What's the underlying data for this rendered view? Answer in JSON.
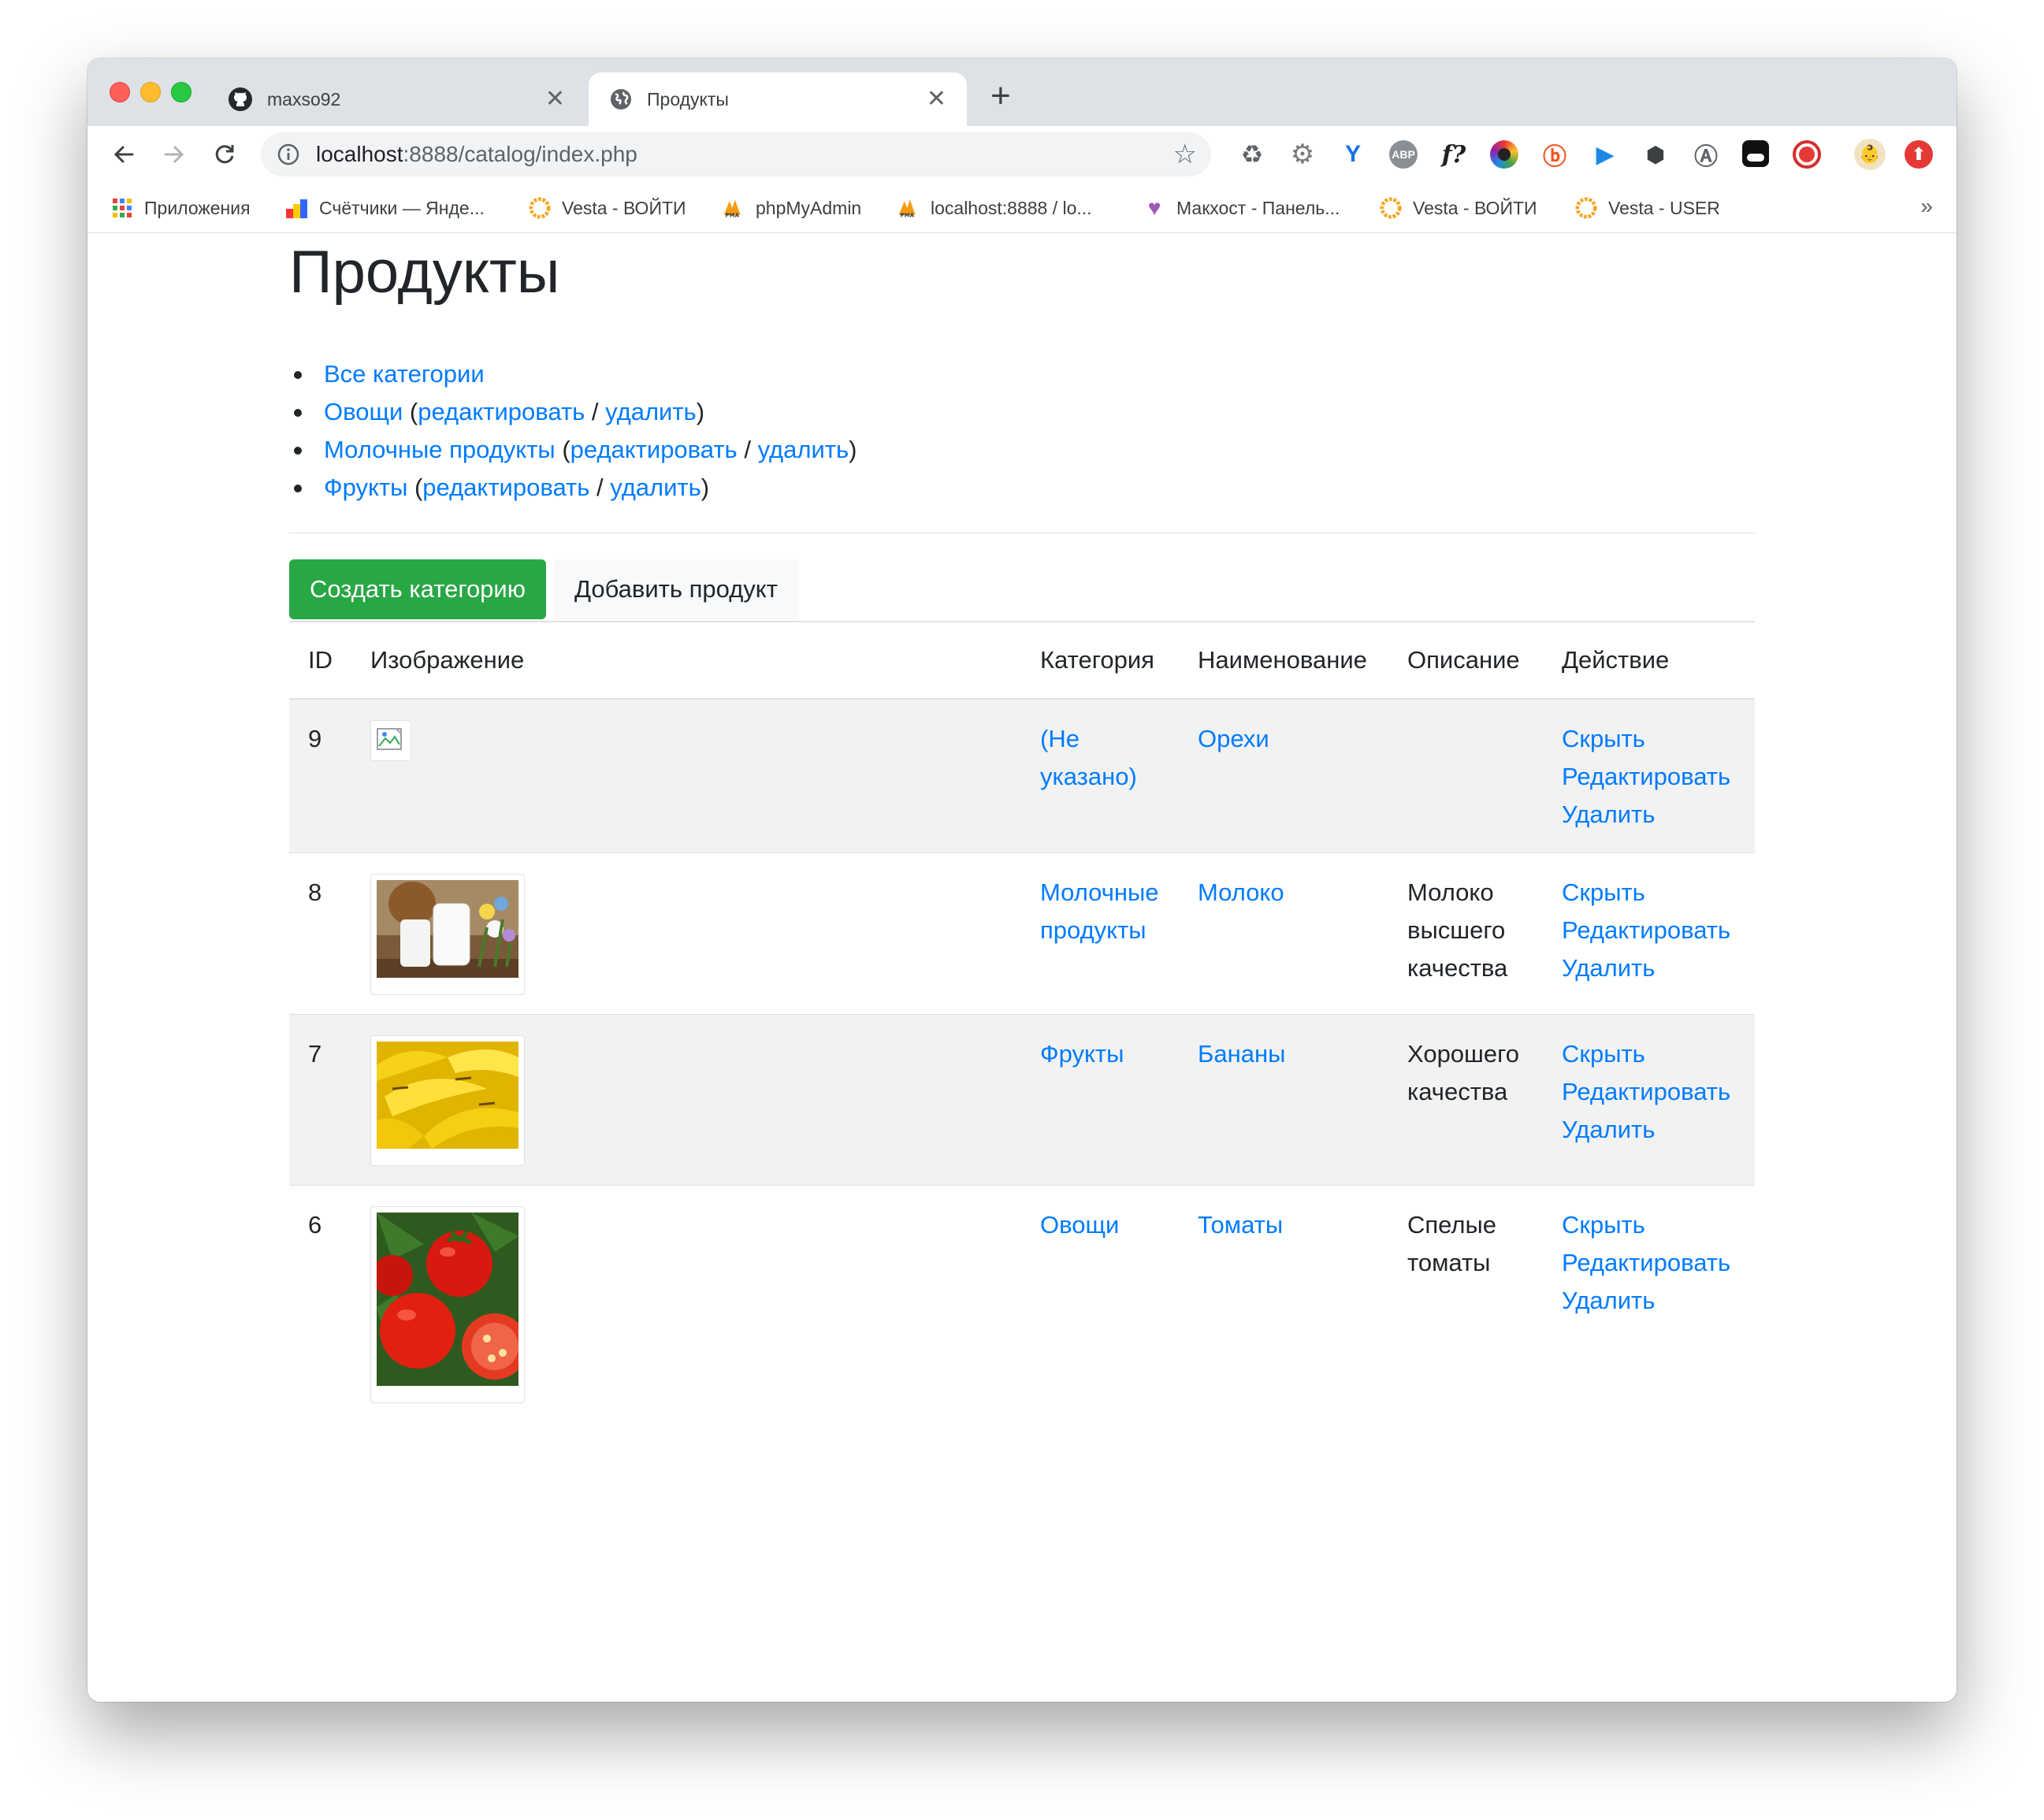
{
  "browser": {
    "tabs": [
      {
        "title": "maxso92",
        "icon": "github-icon",
        "active": false
      },
      {
        "title": "Продукты",
        "icon": "globe-icon",
        "active": true
      }
    ],
    "url_host": "localhost",
    "url_rest": ":8888/catalog/index.php",
    "bookmarks": [
      {
        "label": "Приложения",
        "icon": "apps-grid-icon"
      },
      {
        "label": "Счётчики — Янде...",
        "icon": "metrika-icon"
      },
      {
        "label": "Vesta - ВОЙТИ",
        "icon": "vesta-icon"
      },
      {
        "label": "phpMyAdmin",
        "icon": "pma-icon"
      },
      {
        "label": "localhost:8888 / lo...",
        "icon": "pma-icon"
      },
      {
        "label": "Макхост - Панель...",
        "icon": "heart-icon"
      },
      {
        "label": "Vesta - ВОЙТИ",
        "icon": "vesta-icon"
      },
      {
        "label": "Vesta - USER",
        "icon": "vesta-icon"
      }
    ]
  },
  "page": {
    "title": "Продукты",
    "categories": {
      "all": "Все категории",
      "items": [
        {
          "name": "Овощи",
          "edit": "редактировать",
          "delete": "удалить"
        },
        {
          "name": "Молочные продукты",
          "edit": "редактировать",
          "delete": "удалить"
        },
        {
          "name": "Фрукты",
          "edit": "редактировать",
          "delete": "удалить"
        }
      ]
    },
    "buttons": {
      "create_category": "Создать категорию",
      "add_product": "Добавить продукт"
    },
    "table": {
      "headers": [
        "ID",
        "Изображение",
        "Категория",
        "Наименование",
        "Описание",
        "Действие"
      ],
      "actions": {
        "hide": "Скрыть",
        "edit": "Редактировать",
        "delete": "Удалить"
      },
      "rows": [
        {
          "id": "9",
          "image": "broken-image",
          "category": "(Не указано)",
          "name": "Орехи",
          "description": ""
        },
        {
          "id": "8",
          "image": "milk-photo",
          "category": "Молочные продукты",
          "name": "Молоко",
          "description": "Молоко высшего качества"
        },
        {
          "id": "7",
          "image": "bananas-photo",
          "category": "Фрукты",
          "name": "Бананы",
          "description": "Хорошего качества"
        },
        {
          "id": "6",
          "image": "tomatoes-photo",
          "category": "Овощи",
          "name": "Томаты",
          "description": "Спелые томаты"
        }
      ]
    }
  },
  "colors": {
    "link": "#007bff",
    "success": "#28a745",
    "stripe": "#f2f2f2"
  }
}
